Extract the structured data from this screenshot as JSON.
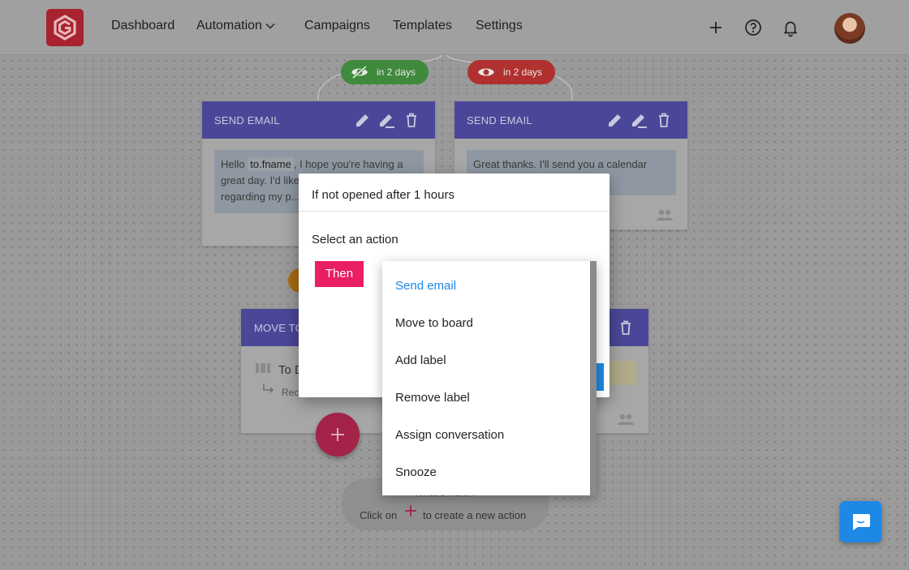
{
  "nav": {
    "links": [
      "Dashboard",
      "Automation",
      "Campaigns",
      "Templates",
      "Settings"
    ],
    "icons": [
      "plus-icon",
      "help-circle-icon",
      "bell-icon"
    ]
  },
  "flow": {
    "branch_not_opened": {
      "label": "in 2 days",
      "color": "#3f8a3c",
      "icon": "eye-off-icon"
    },
    "branch_opened": {
      "label": "in 2 days",
      "color": "#b0312f",
      "icon": "eye-icon"
    },
    "card_left": {
      "header": "SEND EMAIL",
      "body_pre": "Hello ",
      "body_chip": "to.fname",
      "body_post": ", I hope you're having a great day. I'd like",
      "body_line3": "regarding my p..."
    },
    "card_right": {
      "header": "SEND EMAIL",
      "body": "Great thanks. I'll send you a calendar"
    },
    "card_move": {
      "header": "MOVE TO",
      "line1": "To D",
      "line2": "Rec"
    },
    "hint": {
      "line1": "What's next ?",
      "click_on": "Click on",
      "to_create": "to create a new action"
    }
  },
  "modal": {
    "title": "If not opened after 1 hours",
    "select_label": "Select an action",
    "then_label": "Then",
    "options": [
      "Send email",
      "Move to board",
      "Add label",
      "Remove label",
      "Assign conversation",
      "Snooze"
    ],
    "selected": "Send email",
    "accent": "#1e88e5",
    "then_color": "#e91e63"
  }
}
